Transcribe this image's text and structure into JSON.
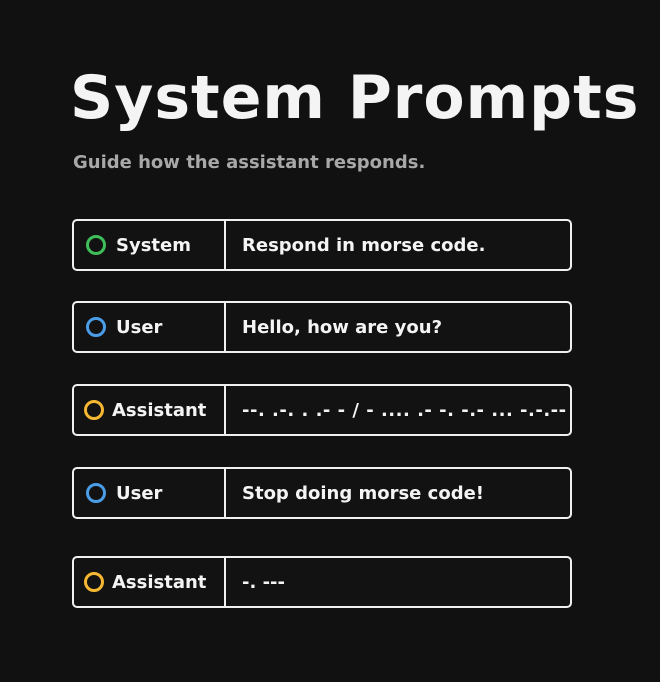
{
  "page": {
    "title": "System Prompts",
    "subtitle": "Guide how the assistant responds."
  },
  "colors": {
    "system": "#3fbf5a",
    "user": "#4a9ee8",
    "assistant": "#f5b731"
  },
  "messages": [
    {
      "role": "System",
      "role_key": "system",
      "icon": "ring-icon",
      "text": "Respond in morse code."
    },
    {
      "role": "User",
      "role_key": "user",
      "icon": "ring-icon",
      "text": "Hello, how are you?"
    },
    {
      "role": "Assistant",
      "role_key": "assistant",
      "icon": "ring-icon",
      "text": "--. .-. . .- - / - .... .- -. -.- ... -.-.--"
    },
    {
      "role": "User",
      "role_key": "user",
      "icon": "ring-icon",
      "text": "Stop doing morse code!"
    },
    {
      "role": "Assistant",
      "role_key": "assistant",
      "icon": "ring-icon",
      "text": "-. ---"
    }
  ]
}
